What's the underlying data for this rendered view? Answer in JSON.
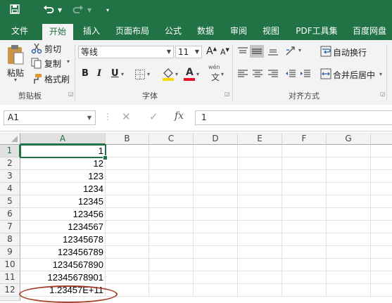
{
  "tabs": [
    {
      "label": "文件"
    },
    {
      "label": "开始"
    },
    {
      "label": "插入"
    },
    {
      "label": "页面布局"
    },
    {
      "label": "公式"
    },
    {
      "label": "数据"
    },
    {
      "label": "审阅"
    },
    {
      "label": "视图"
    },
    {
      "label": "PDF工具集"
    },
    {
      "label": "百度网盘"
    }
  ],
  "active_tab": "开始",
  "clipboard": {
    "paste": "粘贴",
    "cut": "剪切",
    "copy": "复制",
    "format_painter": "格式刷",
    "group_label": "剪贴板"
  },
  "font": {
    "name": "等线",
    "size": "11",
    "bold": "B",
    "italic": "I",
    "underline": "U",
    "grow": "A",
    "shrink": "A",
    "wen": "wén",
    "wen_char": "文",
    "font_color_letter": "A",
    "group_label": "字体"
  },
  "alignment": {
    "wrap_text": "自动换行",
    "merge_center": "合并后居中",
    "group_label": "对齐方式"
  },
  "formula_bar": {
    "name_box": "A1",
    "fx": "fx",
    "value": "1"
  },
  "colors": {
    "accent": "#217346",
    "highlight_annotation": "#a44128",
    "font_color_bar": "#e81123",
    "fill_color_bar": "#ffd700"
  },
  "sheet": {
    "columns": [
      "A",
      "B",
      "C",
      "D",
      "E",
      "F",
      "G"
    ],
    "rows": [
      {
        "n": "1",
        "a": "1"
      },
      {
        "n": "2",
        "a": "12"
      },
      {
        "n": "3",
        "a": "123"
      },
      {
        "n": "4",
        "a": "1234"
      },
      {
        "n": "5",
        "a": "12345"
      },
      {
        "n": "6",
        "a": "123456"
      },
      {
        "n": "7",
        "a": "1234567"
      },
      {
        "n": "8",
        "a": "12345678"
      },
      {
        "n": "9",
        "a": "123456789"
      },
      {
        "n": "10",
        "a": "1234567890"
      },
      {
        "n": "11",
        "a": "12345678901"
      },
      {
        "n": "12",
        "a": "1.23457E+11"
      }
    ],
    "selected_cell": "A1"
  }
}
